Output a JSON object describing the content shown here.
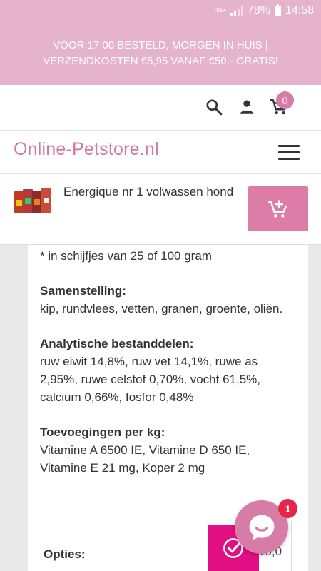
{
  "status_bar": {
    "network": "4G+",
    "battery": "78%",
    "time": "14:58"
  },
  "banner": {
    "line1": "VOOR 17:00 BESTELD, MORGEN IN HUIS |",
    "line2": "VERZENDKOSTEN €5,95 VANAF €50,- GRATIS!"
  },
  "header": {
    "cart_count": "0",
    "logo": "Online-Petstore.nl"
  },
  "product_bar": {
    "name": "Energique nr 1 volwassen hond"
  },
  "content": {
    "slices_line": "* in schijfjes van 25 of 100 gram",
    "composition_title": "Samenstelling:",
    "composition_text": "kip, rundvlees, vetten, granen, groente, oliën.",
    "analytic_title": "Analytische bestanddelen:",
    "analytic_text": "ruw eiwit 14,8%, ruw vet 14,1%, ruwe as 2,95%, ruwe celstof 0,70%, vocht 61,5%, calcium 0,66%, fosfor 0,48%",
    "additions_title": "Toevoegingen per kg:",
    "additions_text": "Vitamine A 6500 IE, Vitamine D 650 IE, Vitamine E 21 mg, Koper 2 mg",
    "options_label": "Opties:",
    "price_partial": "10,0"
  },
  "chat": {
    "badge": "1"
  },
  "colors": {
    "brand_pink": "#e5b3cb",
    "accent_pink": "#dd7ca6",
    "magenta": "#e00f83",
    "badge_red": "#e4264a"
  }
}
